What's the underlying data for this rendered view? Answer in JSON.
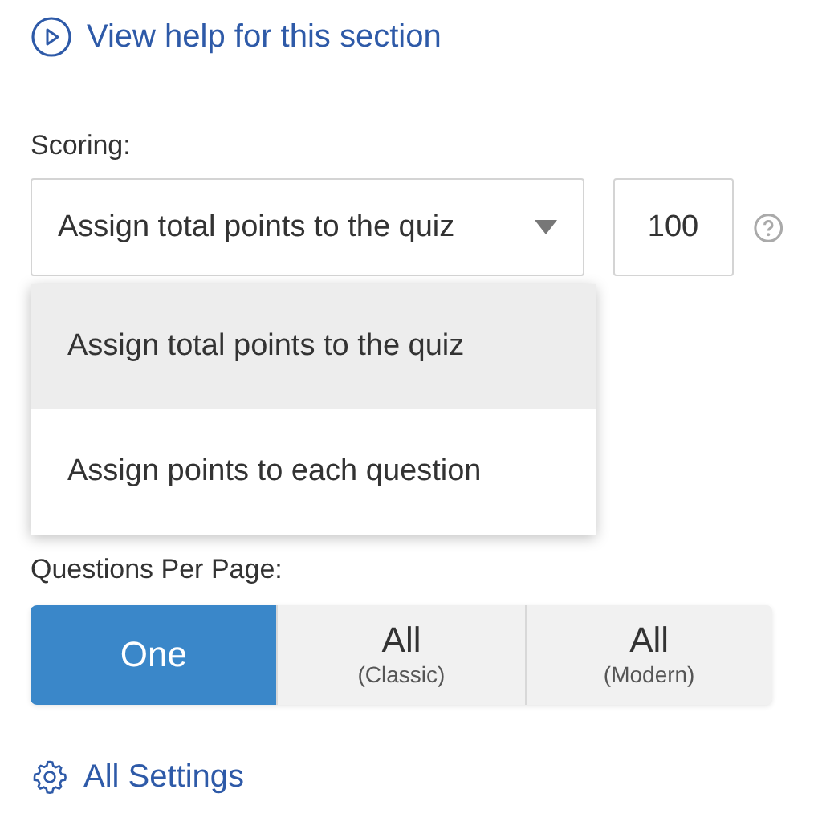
{
  "help_link": {
    "label": "View help for this section"
  },
  "scoring": {
    "label": "Scoring:",
    "select": {
      "value": "Assign total points to the quiz",
      "expanded": true
    },
    "points": {
      "value": "100"
    },
    "options": [
      {
        "label": "Assign total points to the quiz",
        "selected": true
      },
      {
        "label": "Assign points to each question",
        "selected": false
      }
    ]
  },
  "questions_per_page": {
    "label": "Questions Per Page:",
    "segments": [
      {
        "label": "One",
        "selected": true
      },
      {
        "label": "All",
        "sublabel": "(Classic)",
        "selected": false
      },
      {
        "label": "All",
        "sublabel": "(Modern)",
        "selected": false
      }
    ]
  },
  "settings_link": {
    "label": "All Settings"
  }
}
